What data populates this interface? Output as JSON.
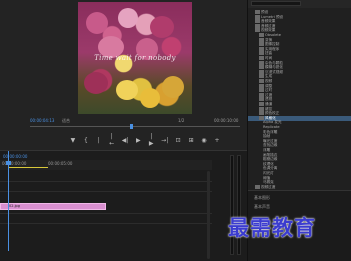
{
  "monitor": {
    "video_caption": "Time wait for nobody",
    "timecode_left": "00:00:04:13",
    "fit_label": "适合",
    "ratio_label": "1/2",
    "timecode_right": "00:00:10:00",
    "transport": [
      "▼",
      "{",
      "|",
      "|←",
      "◀|",
      "▶",
      "|▶",
      "→|",
      "⊡",
      "⊞",
      "◉",
      "+"
    ]
  },
  "effects": {
    "tree": [
      {
        "label": "预设",
        "indent": 1,
        "folder": true
      },
      {
        "label": "Lumetri 预设",
        "indent": 1,
        "folder": true
      },
      {
        "label": "音频效果",
        "indent": 1,
        "folder": true
      },
      {
        "label": "音频过渡",
        "indent": 1,
        "folder": true
      },
      {
        "label": "视频效果",
        "indent": 1,
        "folder": true
      },
      {
        "label": "Obsolete",
        "indent": 2,
        "folder": true
      },
      {
        "label": "变换",
        "indent": 2,
        "folder": true
      },
      {
        "label": "图像控制",
        "indent": 2,
        "folder": true
      },
      {
        "label": "实用程序",
        "indent": 2,
        "folder": true
      },
      {
        "label": "扭曲",
        "indent": 2,
        "folder": true
      },
      {
        "label": "时间",
        "indent": 2,
        "folder": true
      },
      {
        "label": "杂色与颗粒",
        "indent": 2,
        "folder": true
      },
      {
        "label": "模糊与锐化",
        "indent": 2,
        "folder": true
      },
      {
        "label": "沉浸式视频",
        "indent": 2,
        "folder": true
      },
      {
        "label": "生成",
        "indent": 2,
        "folder": true
      },
      {
        "label": "视频",
        "indent": 2,
        "folder": true
      },
      {
        "label": "调整",
        "indent": 2,
        "folder": true
      },
      {
        "label": "过时",
        "indent": 2,
        "folder": true
      },
      {
        "label": "过渡",
        "indent": 2,
        "folder": true
      },
      {
        "label": "透视",
        "indent": 2,
        "folder": true
      },
      {
        "label": "通道",
        "indent": 2,
        "folder": true
      },
      {
        "label": "键控",
        "indent": 2,
        "folder": true
      },
      {
        "label": "颜色校正",
        "indent": 2,
        "folder": true
      },
      {
        "label": "风格化",
        "indent": 2,
        "folder": true,
        "selected": true
      },
      {
        "label": "Alpha 发光",
        "indent": 3,
        "folder": false
      },
      {
        "label": "Replicate",
        "indent": 3,
        "folder": false
      },
      {
        "label": "彩色浮雕",
        "indent": 3,
        "folder": false
      },
      {
        "label": "抽帧",
        "indent": 3,
        "folder": false
      },
      {
        "label": "曝光过度",
        "indent": 3,
        "folder": false
      },
      {
        "label": "查找边缘",
        "indent": 3,
        "folder": false
      },
      {
        "label": "浮雕",
        "indent": 3,
        "folder": false
      },
      {
        "label": "画笔描边",
        "indent": 3,
        "folder": false
      },
      {
        "label": "粗糙边缘",
        "indent": 3,
        "folder": false
      },
      {
        "label": "纹理化",
        "indent": 3,
        "folder": false
      },
      {
        "label": "色调分离",
        "indent": 3,
        "folder": false
      },
      {
        "label": "闪光灯",
        "indent": 3,
        "folder": false
      },
      {
        "label": "阈值",
        "indent": 3,
        "folder": false
      },
      {
        "label": "马赛克",
        "indent": 3,
        "folder": false
      },
      {
        "label": "视频过渡",
        "indent": 1,
        "folder": true
      }
    ],
    "bottom_labels": [
      "基本图形",
      "基本声音"
    ]
  },
  "timeline": {
    "ruler_start": "00:00:00:00",
    "ruler_mark": "00:00:05:00",
    "clip_name": "02.jpg"
  },
  "watermark": "最需教育"
}
